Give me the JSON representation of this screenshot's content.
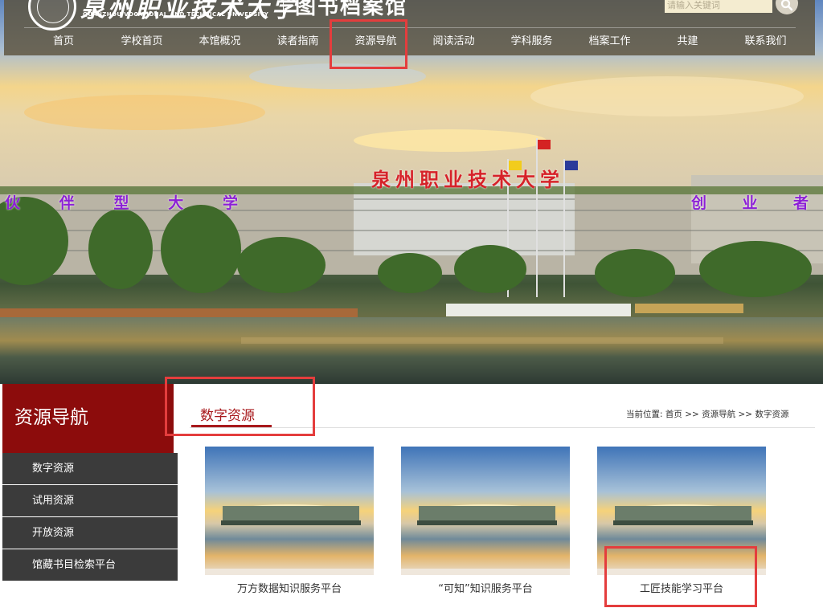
{
  "header": {
    "logo_cn": "泉州职业技术大学",
    "logo_en": "QUANZHOU VOCATIONAL AND TECHNICAL UNIVERSITY",
    "library_name": "图书档案馆",
    "search_placeholder": "请输入关键词",
    "nav": [
      {
        "label": "首页"
      },
      {
        "label": "学校首页"
      },
      {
        "label": "本馆概况"
      },
      {
        "label": "读者指南"
      },
      {
        "label": "资源导航"
      },
      {
        "label": "阅读活动"
      },
      {
        "label": "学科服务"
      },
      {
        "label": "档案工作"
      },
      {
        "label": "共建"
      },
      {
        "label": "联系我们"
      }
    ]
  },
  "banner": {
    "building_sign": "泉州职业技术大学",
    "slogan_left": [
      "伙",
      "伴",
      "型",
      "大",
      "学"
    ],
    "slogan_right": [
      "创",
      "业",
      "者"
    ]
  },
  "sidebar": {
    "title": "资源导航",
    "items": [
      {
        "label": "数字资源"
      },
      {
        "label": "试用资源"
      },
      {
        "label": "开放资源"
      },
      {
        "label": "馆藏书目检索平台"
      }
    ]
  },
  "main": {
    "tab_title": "数字资源",
    "breadcrumb": {
      "prefix": "当前位置:",
      "items": [
        "首页",
        "资源导航",
        "数字资源"
      ],
      "separator": " >> "
    },
    "cards": [
      {
        "label": "万方数据知识服务平台"
      },
      {
        "label": "“可知”知识服务平台"
      },
      {
        "label": "工匠技能学习平台"
      }
    ]
  },
  "colors": {
    "accent": "#a8191c",
    "sidebar_header": "#8c0c0c",
    "sidebar_item": "#3b3b3b",
    "highlight_box": "#e43d3d"
  }
}
